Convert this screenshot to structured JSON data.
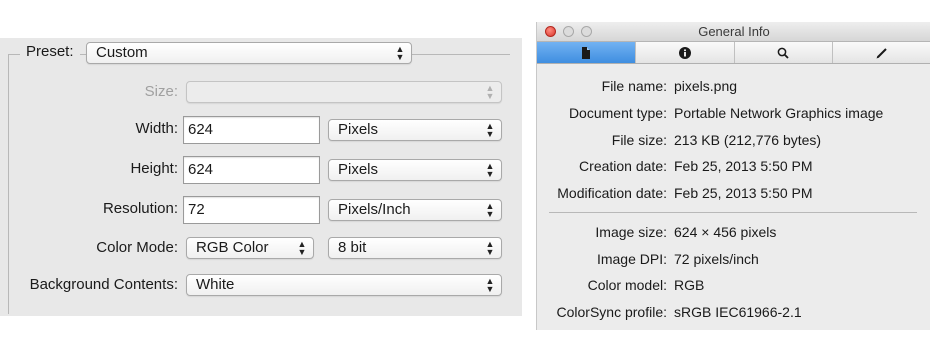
{
  "new_image_dialog": {
    "preset": {
      "label": "Preset:",
      "value": "Custom"
    },
    "size": {
      "label": "Size:",
      "value": ""
    },
    "width": {
      "label": "Width:",
      "value": "624",
      "unit": "Pixels"
    },
    "height": {
      "label": "Height:",
      "value": "624",
      "unit": "Pixels"
    },
    "resolution": {
      "label": "Resolution:",
      "value": "72",
      "unit": "Pixels/Inch"
    },
    "color_mode": {
      "label": "Color Mode:",
      "value": "RGB Color",
      "bit_depth": "8 bit"
    },
    "background_contents": {
      "label": "Background Contents:",
      "value": "White"
    }
  },
  "info_window": {
    "title": "General Info",
    "tabs": [
      {
        "icon": "document-icon",
        "selected": true
      },
      {
        "icon": "info-icon",
        "selected": false
      },
      {
        "icon": "magnifier-icon",
        "selected": false
      },
      {
        "icon": "pencil-icon",
        "selected": false
      }
    ],
    "file_name": {
      "label": "File name:",
      "value": "pixels.png"
    },
    "document_type": {
      "label": "Document type:",
      "value": "Portable Network Graphics image"
    },
    "file_size": {
      "label": "File size:",
      "value": "213 KB (212,776 bytes)"
    },
    "creation_date": {
      "label": "Creation date:",
      "value": "Feb 25, 2013 5:50 PM"
    },
    "modification_date": {
      "label": "Modification date:",
      "value": "Feb 25, 2013 5:50 PM"
    },
    "image_size": {
      "label": "Image size:",
      "value": "624 × 456 pixels"
    },
    "image_dpi": {
      "label": "Image DPI:",
      "value": "72 pixels/inch"
    },
    "color_model": {
      "label": "Color model:",
      "value": "RGB"
    },
    "colorsync_profile": {
      "label": "ColorSync profile:",
      "value": "sRGB IEC61966-2.1"
    }
  },
  "colors": {
    "selected_tab": "#4a97e6",
    "close_button": "#e0443a"
  }
}
